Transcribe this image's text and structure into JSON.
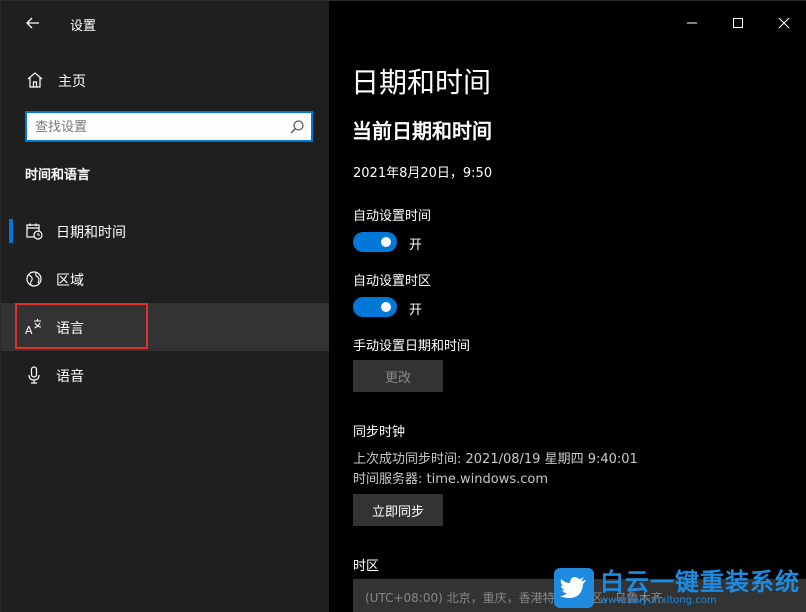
{
  "app": {
    "title": "设置"
  },
  "sidebar": {
    "home_label": "主页",
    "search_placeholder": "查找设置",
    "section_title": "时间和语言",
    "items": [
      {
        "label": "日期和时间",
        "icon": "calendar-clock-icon",
        "selected": true
      },
      {
        "label": "区域",
        "icon": "globe-icon"
      },
      {
        "label": "语言",
        "icon": "language-icon",
        "hovered": true
      },
      {
        "label": "语音",
        "icon": "microphone-icon"
      }
    ]
  },
  "main": {
    "page_title": "日期和时间",
    "sub_title": "当前日期和时间",
    "current_datetime": "2021年8月20日，9:50",
    "auto_time": {
      "label": "自动设置时间",
      "state": "开"
    },
    "auto_timezone": {
      "label": "自动设置时区",
      "state": "开"
    },
    "manual": {
      "label": "手动设置日期和时间",
      "button": "更改"
    },
    "sync": {
      "title": "同步时钟",
      "last_sync": "上次成功同步时间: 2021/08/19 星期四 9:40:01",
      "server": "时间服务器: time.windows.com",
      "button": "立即同步"
    },
    "timezone": {
      "title": "时区",
      "value": "(UTC+08:00) 北京，重庆，香港特别行政区，乌鲁木齐"
    }
  },
  "watermark": {
    "title": "白云一键重装系统",
    "url": "www.baiyunxitong.com"
  },
  "colors": {
    "accent": "#0078d7",
    "highlight_box": "#e0312d"
  }
}
